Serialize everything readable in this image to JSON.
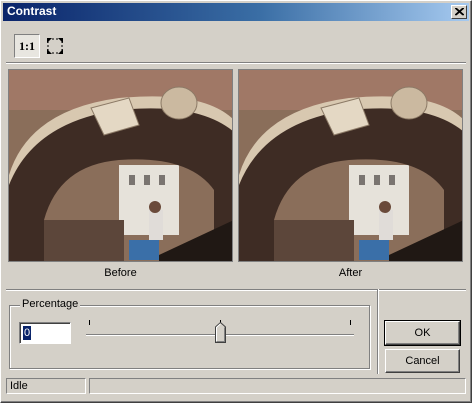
{
  "window": {
    "title": "Contrast"
  },
  "toolbar": {
    "actual_size_label": "1:1",
    "actual_size_icon": "one-to-one",
    "fit_icon": "fit-to-window-icon"
  },
  "preview": {
    "before_label": "Before",
    "after_label": "After"
  },
  "percentage": {
    "group_label": "Percentage",
    "value": "0",
    "slider_value_fraction": 0.5
  },
  "buttons": {
    "ok_label": "OK",
    "cancel_label": "Cancel"
  },
  "status": {
    "text": "Idle"
  },
  "colors": {
    "title_start": "#0a246a",
    "title_end": "#a6caf0",
    "face": "#d4d0c8",
    "selection": "#0a246a"
  }
}
